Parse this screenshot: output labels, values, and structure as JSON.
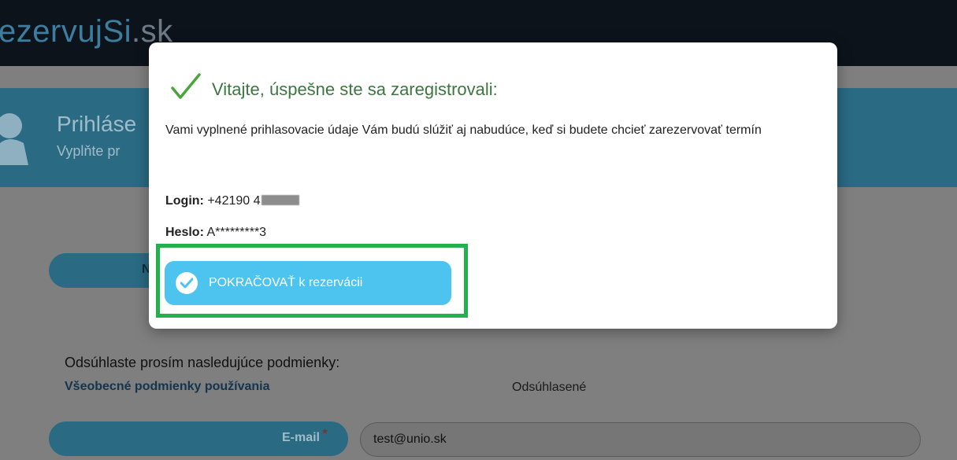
{
  "header": {
    "brand_main": "ezervujSi",
    "brand_suffix": ".sk",
    "title": "Prihláse",
    "subtitle": "Vyplňte pr"
  },
  "background_form": {
    "pill_partial_label": "N",
    "terms_prompt": "Odsúhlaste prosím nasledujúce podmienky:",
    "terms_link": "Všeobecné podmienky používania",
    "terms_status": "Odsúhlasené",
    "email_label": "E-mail",
    "email_required_mark": "*",
    "email_value": "test@unio.sk"
  },
  "modal": {
    "title": "Vitajte, úspešne ste sa zaregistrovali:",
    "message": "Vami vyplnené prihlasovacie údaje Vám budú slúžiť aj nabudúce, keď si budete chcieť zarezervovať termín",
    "login_label": "Login:",
    "login_value": "+42190 4",
    "password_label": "Heslo:",
    "password_value": "A*********3",
    "continue_button": "POKRAČOVAŤ k rezervácii"
  },
  "colors": {
    "success_green": "#3c7640",
    "button_blue": "#4dc3ef",
    "highlight_green": "#22b14c",
    "header_dark": "#0d131b"
  },
  "icons": {
    "title_icon": "check-mark-icon",
    "button_icon": "check-circle-icon",
    "header_icon": "user-icon"
  }
}
